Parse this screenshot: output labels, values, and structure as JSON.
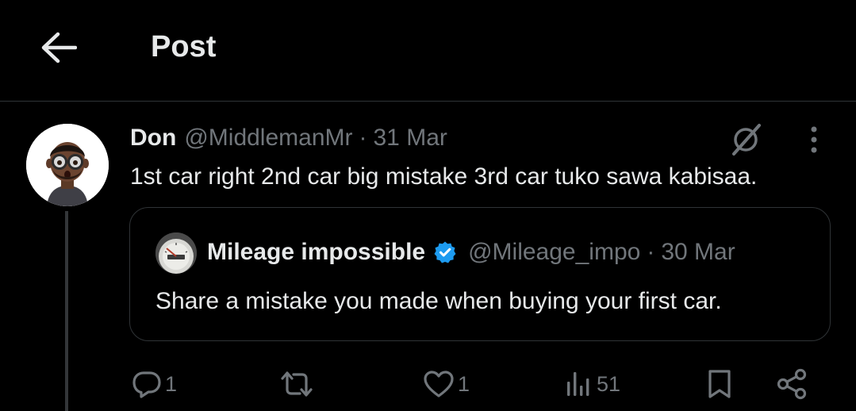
{
  "header": {
    "back_icon": "arrow-left-icon",
    "title": "Post"
  },
  "post": {
    "author_name": "Don",
    "author_handle": "@MiddlemanMr",
    "separator": "·",
    "date": "31 Mar",
    "text": "1st car right 2nd car big mistake 3rd car tuko sawa kabisaa.",
    "avatar_icon": "memoji-avatar",
    "grok_icon": "grok-icon",
    "more_icon": "more-vertical-icon"
  },
  "quote": {
    "author_name": "Mileage impossible",
    "verified": true,
    "verified_color": "#1d9bf0",
    "author_handle": "@Mileage_impo",
    "separator": "·",
    "date": "30 Mar",
    "text": "Share a mistake you made when buying your first car.",
    "avatar_icon": "odometer-avatar"
  },
  "actions": {
    "reply_count": "1",
    "repost_count": "",
    "like_count": "1",
    "views_count": "51"
  },
  "colors": {
    "background": "#000000",
    "text_primary": "#e7e9ea",
    "text_secondary": "#71767b",
    "border": "#2f3336",
    "accent": "#1d9bf0"
  }
}
